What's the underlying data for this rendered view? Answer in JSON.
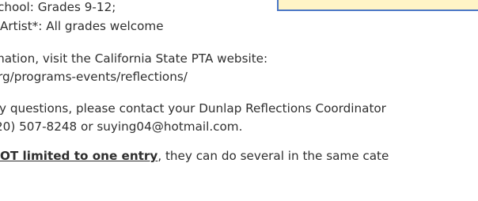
{
  "document": {
    "lines": [
      "chool: Grades 9-12;",
      " Artist*: All grades welcome",
      "mation, visit the California State PTA website:",
      "rg/programs-events/reflections/",
      "y questions, please contact your Dunlap Reflections Coordinator",
      "20) 507-8248 or suying04@hotmail.com."
    ],
    "last_line_bold": "OT limited to one entry",
    "last_line_rest": ", they can do several in the same cate"
  }
}
